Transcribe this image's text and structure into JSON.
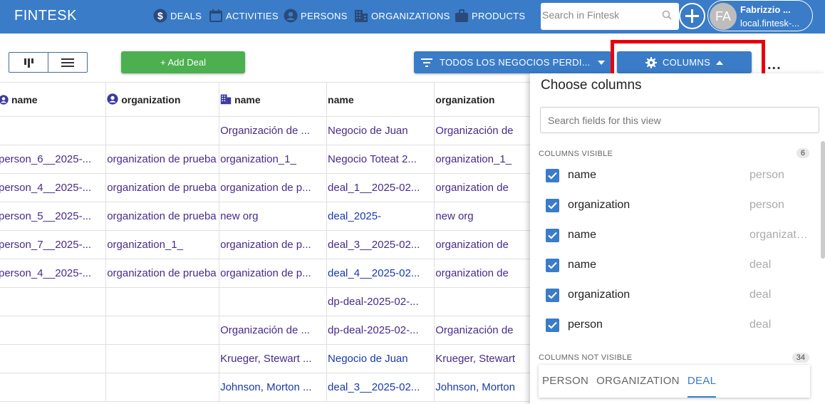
{
  "header": {
    "brand": "FINTESK",
    "nav": [
      {
        "label": "DEALS",
        "icon": "dollar-icon"
      },
      {
        "label": "ACTIVITIES",
        "icon": "calendar-icon"
      },
      {
        "label": "PERSONS",
        "icon": "person-icon"
      },
      {
        "label": "ORGANIZATIONS",
        "icon": "building-icon"
      },
      {
        "label": "PRODUCTS",
        "icon": "briefcase-icon"
      }
    ],
    "search_placeholder": "Search in Fintesk",
    "user_initials": "FA",
    "user_name": "Fabrizzio ...",
    "user_host": "local.fintesk-..."
  },
  "toolbar": {
    "add_deal_label": "+ Add Deal",
    "filter_label": "TODOS LOS NEGOCIOS PERDI...",
    "columns_label": "COLUMNS",
    "more_label": "..."
  },
  "table": {
    "columns": [
      {
        "label": "name",
        "icon": "person-icon"
      },
      {
        "label": "organization",
        "icon": "person-icon"
      },
      {
        "label": "name",
        "icon": "building-icon"
      },
      {
        "label": "name",
        "icon": ""
      },
      {
        "label": "organization",
        "icon": ""
      }
    ],
    "rows": [
      [
        "",
        "",
        "Organización de ...",
        "Negocio de Juan",
        "Organización de"
      ],
      [
        "person_6__2025-...",
        "organization de prueba",
        "organization_1_",
        "Negocio Toteat 2...",
        "organization_1_"
      ],
      [
        "person_4__2025-...",
        "organization de prueba",
        "organization de p...",
        "deal_1__2025-02...",
        "organization de"
      ],
      [
        "person_5__2025-...",
        "organization de prueba",
        "new org",
        "deal_2025-",
        "new org"
      ],
      [
        "person_7__2025-...",
        "organization_1_",
        "organization de p...",
        "deal_3__2025-02...",
        "organization de"
      ],
      [
        "person_4__2025-...",
        "organization de prueba",
        "organization de p...",
        "deal_4__2025-02...",
        "organization de"
      ],
      [
        "",
        "",
        "",
        "dp-deal-2025-02-...",
        ""
      ],
      [
        "",
        "",
        "Organización de ...",
        "dp-deal-2025-02-...",
        "Organización de"
      ],
      [
        "",
        "",
        "Krueger, Stewart ...",
        "Negocio de Juan",
        "Krueger, Stewart"
      ],
      [
        "",
        "",
        "Johnson, Morton ...",
        "deal_3__2025-02...",
        "Johnson, Morton"
      ]
    ]
  },
  "panel": {
    "title": "Choose columns",
    "search_placeholder": "Search fields for this view",
    "visible_header": "COLUMNS VISIBLE",
    "visible_count": "6",
    "visible": [
      {
        "name": "name",
        "type": "person"
      },
      {
        "name": "organization",
        "type": "person"
      },
      {
        "name": "name",
        "type": "organization"
      },
      {
        "name": "name",
        "type": "deal"
      },
      {
        "name": "organization",
        "type": "deal"
      },
      {
        "name": "person",
        "type": "deal"
      }
    ],
    "not_visible_header": "COLUMNS NOT VISIBLE",
    "not_visible_count": "34",
    "tabs": [
      "PERSON",
      "ORGANIZATION",
      "DEAL"
    ],
    "active_tab": "DEAL"
  },
  "colors": {
    "primary": "#3a7cc7",
    "add": "#4caf50",
    "highlight": "#e8000d"
  }
}
